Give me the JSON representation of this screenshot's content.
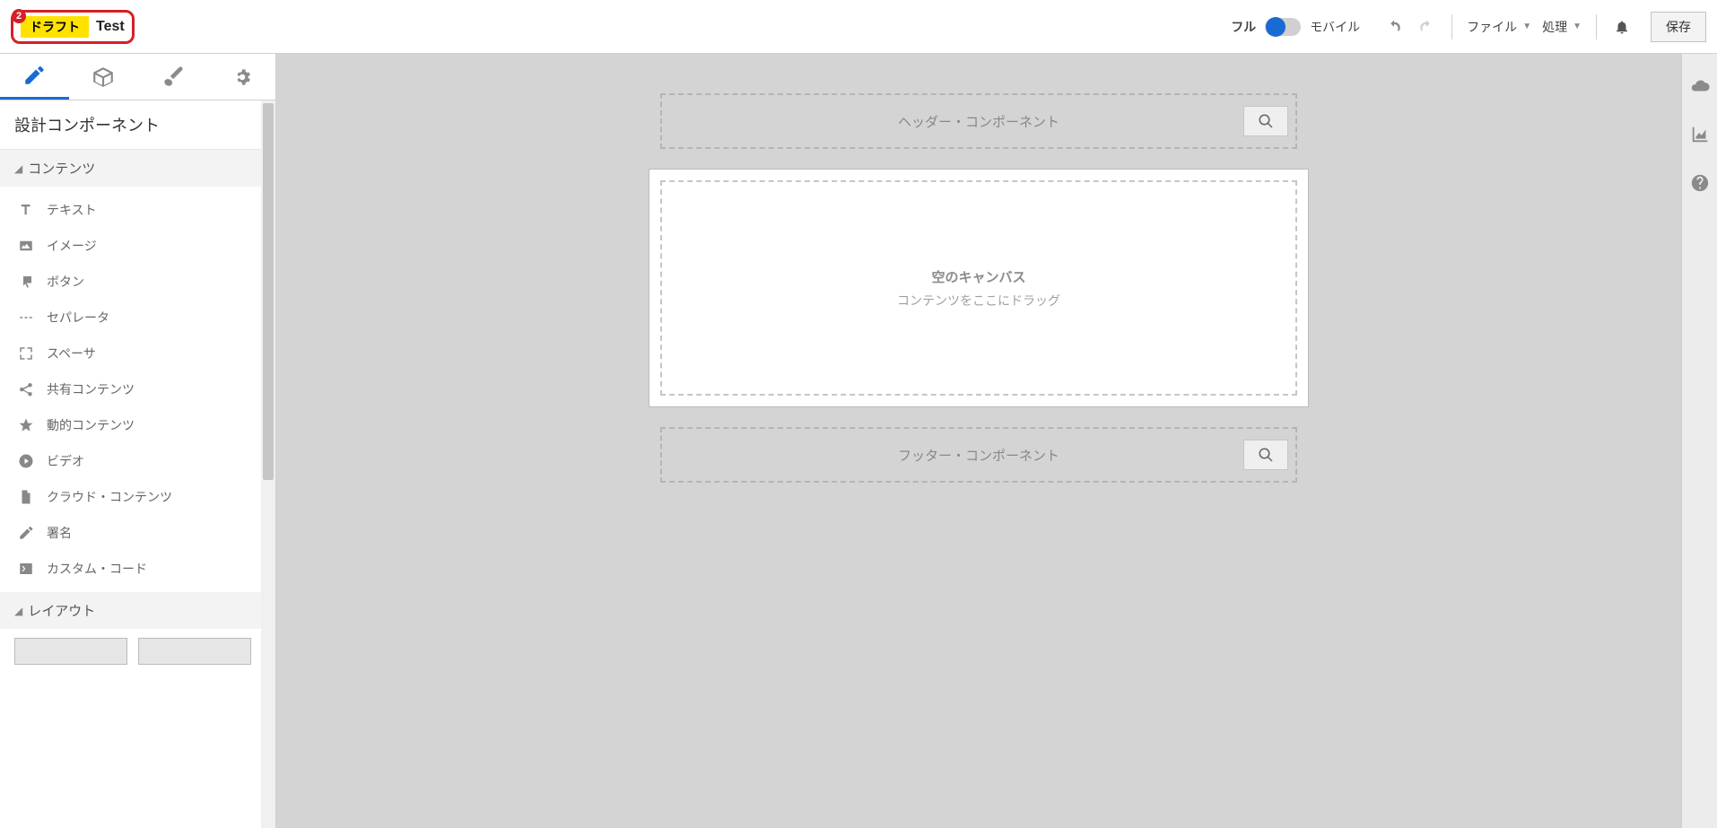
{
  "header": {
    "badge_number": "2",
    "draft_label": "ドラフト",
    "title": "Test",
    "view_full": "フル",
    "view_mobile": "モバイル",
    "file_menu": "ファイル",
    "process_menu": "処理",
    "save_button": "保存"
  },
  "sidebar": {
    "panel_title": "設計コンポーネント",
    "section_contents": "コンテンツ",
    "section_layout": "レイアウト",
    "items": [
      {
        "icon": "text",
        "label": "テキスト"
      },
      {
        "icon": "image",
        "label": "イメージ"
      },
      {
        "icon": "button",
        "label": "ボタン"
      },
      {
        "icon": "divider",
        "label": "セパレータ"
      },
      {
        "icon": "spacer",
        "label": "スペーサ"
      },
      {
        "icon": "share",
        "label": "共有コンテンツ"
      },
      {
        "icon": "star",
        "label": "動的コンテンツ"
      },
      {
        "icon": "video",
        "label": "ビデオ"
      },
      {
        "icon": "cloud",
        "label": "クラウド・コンテンツ"
      },
      {
        "icon": "pen",
        "label": "署名"
      },
      {
        "icon": "code",
        "label": "カスタム・コード"
      }
    ]
  },
  "canvas": {
    "header_zone": "ヘッダー・コンポーネント",
    "footer_zone": "フッター・コンポーネント",
    "empty_title": "空のキャンバス",
    "empty_sub": "コンテンツをここにドラッグ"
  }
}
